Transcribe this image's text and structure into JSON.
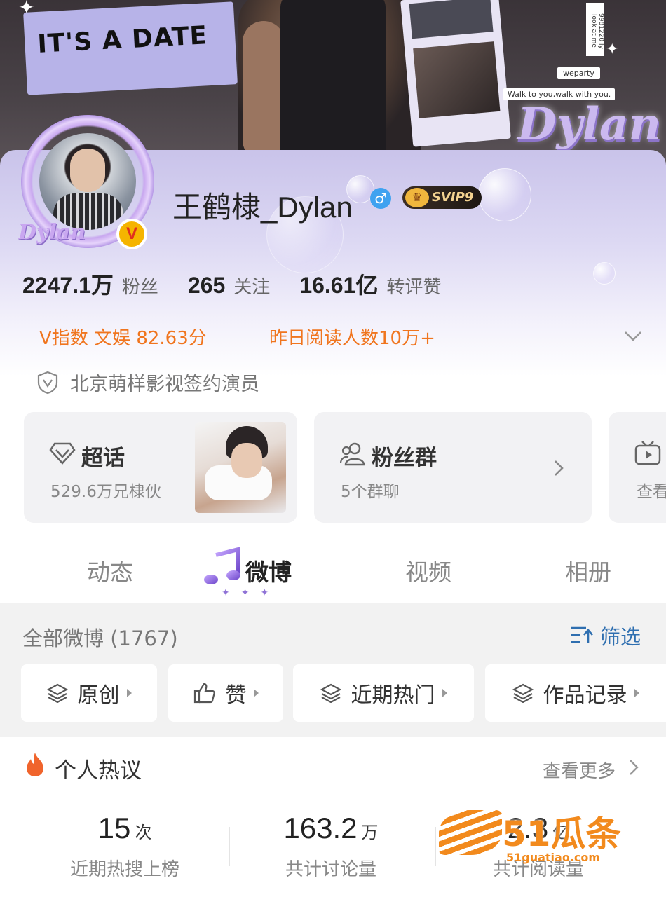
{
  "banner": {
    "title": "IT'S A DATE",
    "tag1": "weparty",
    "tag2": "Walk to you,walk with you.",
    "vertical": "9981220 ly look at me",
    "logo": "Dylan"
  },
  "profile": {
    "avatar_logo": "Dylan",
    "verified_badge": "V",
    "username": "王鹤棣_Dylan",
    "gender_symbol": "♂",
    "svip_label": "SVIP9",
    "stats": [
      {
        "value": "2247.1万",
        "label": "粉丝"
      },
      {
        "value": "265",
        "label": "关注"
      },
      {
        "value": "16.61亿",
        "label": "转评赞"
      }
    ],
    "v_index": "V指数 文娱 82.63分",
    "yesterday_reads": "昨日阅读人数10万+",
    "certification": "北京萌样影视签约演员"
  },
  "cards": [
    {
      "title": "超话",
      "subtitle": "529.6万兄棣伙"
    },
    {
      "title": "粉丝群",
      "subtitle": "5个群聊"
    },
    {
      "title": "",
      "subtitle": "查看"
    }
  ],
  "tabs": [
    {
      "label": "动态",
      "active": false
    },
    {
      "label": "微博",
      "active": true
    },
    {
      "label": "视频",
      "active": false
    },
    {
      "label": "相册",
      "active": false
    }
  ],
  "feed": {
    "title": "全部微博 (1767)",
    "filter_label": "筛选",
    "chips": [
      "原创",
      "赞",
      "近期热门",
      "作品记录"
    ]
  },
  "hot": {
    "title": "个人热议",
    "more": "查看更多",
    "metrics": [
      {
        "value": "15",
        "unit": "次",
        "label": "近期热搜上榜"
      },
      {
        "value": "163.2",
        "unit": "万",
        "label": "共计讨论量"
      },
      {
        "value": "2.3",
        "unit": "亿",
        "label": "共计阅读量"
      }
    ]
  },
  "watermark": {
    "text": "51瓜条",
    "url": "51guatiao.com"
  },
  "colors": {
    "accent_orange": "#f0751e",
    "link_blue": "#2f6fb0",
    "vip_gold": "#f3d290",
    "profile_lilac": "#c9c3ea"
  }
}
